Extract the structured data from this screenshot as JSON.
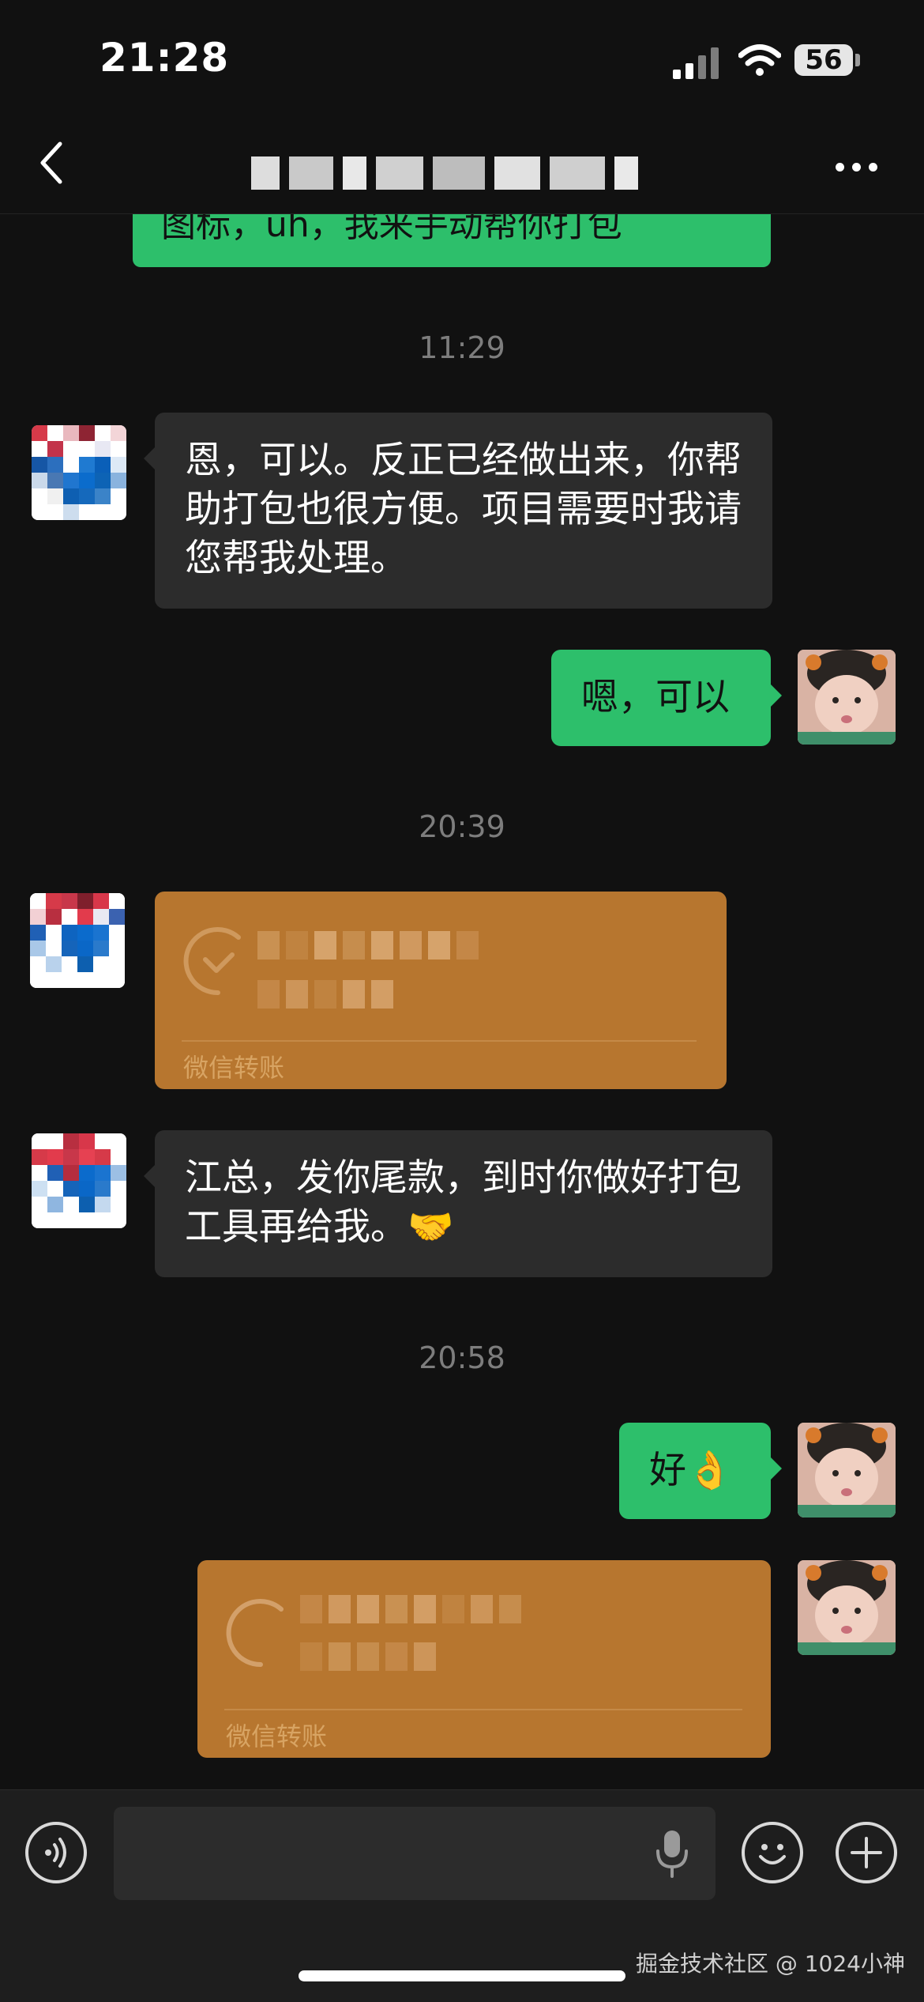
{
  "status_bar": {
    "time": "21:28",
    "battery": "56"
  },
  "nav": {
    "back_icon": "chevron-left-icon",
    "more_icon": "ellipsis-icon"
  },
  "messages": {
    "partial_top_text": "图标，uh，我来手动帮你打包",
    "ts1": "11:29",
    "msg1": "恩，可以。反正已经做出来，你帮助打包也很方便。项目需要时我请您帮我处理。",
    "msg2": "嗯，可以",
    "ts2": "20:39",
    "transfer1_label": "微信转账",
    "msg3": "江总，发你尾款，到时你做好打包工具再给我。🤝",
    "ts3": "20:58",
    "msg4": "好👌",
    "transfer2_label": "微信转账"
  },
  "input": {
    "placeholder": ""
  },
  "watermark": "掘金技术社区 @ 1024小神",
  "colors": {
    "background": "#111111",
    "green_bubble": "#2dbf6b",
    "dark_bubble": "#2c2c2c",
    "transfer": "#b7762f"
  }
}
